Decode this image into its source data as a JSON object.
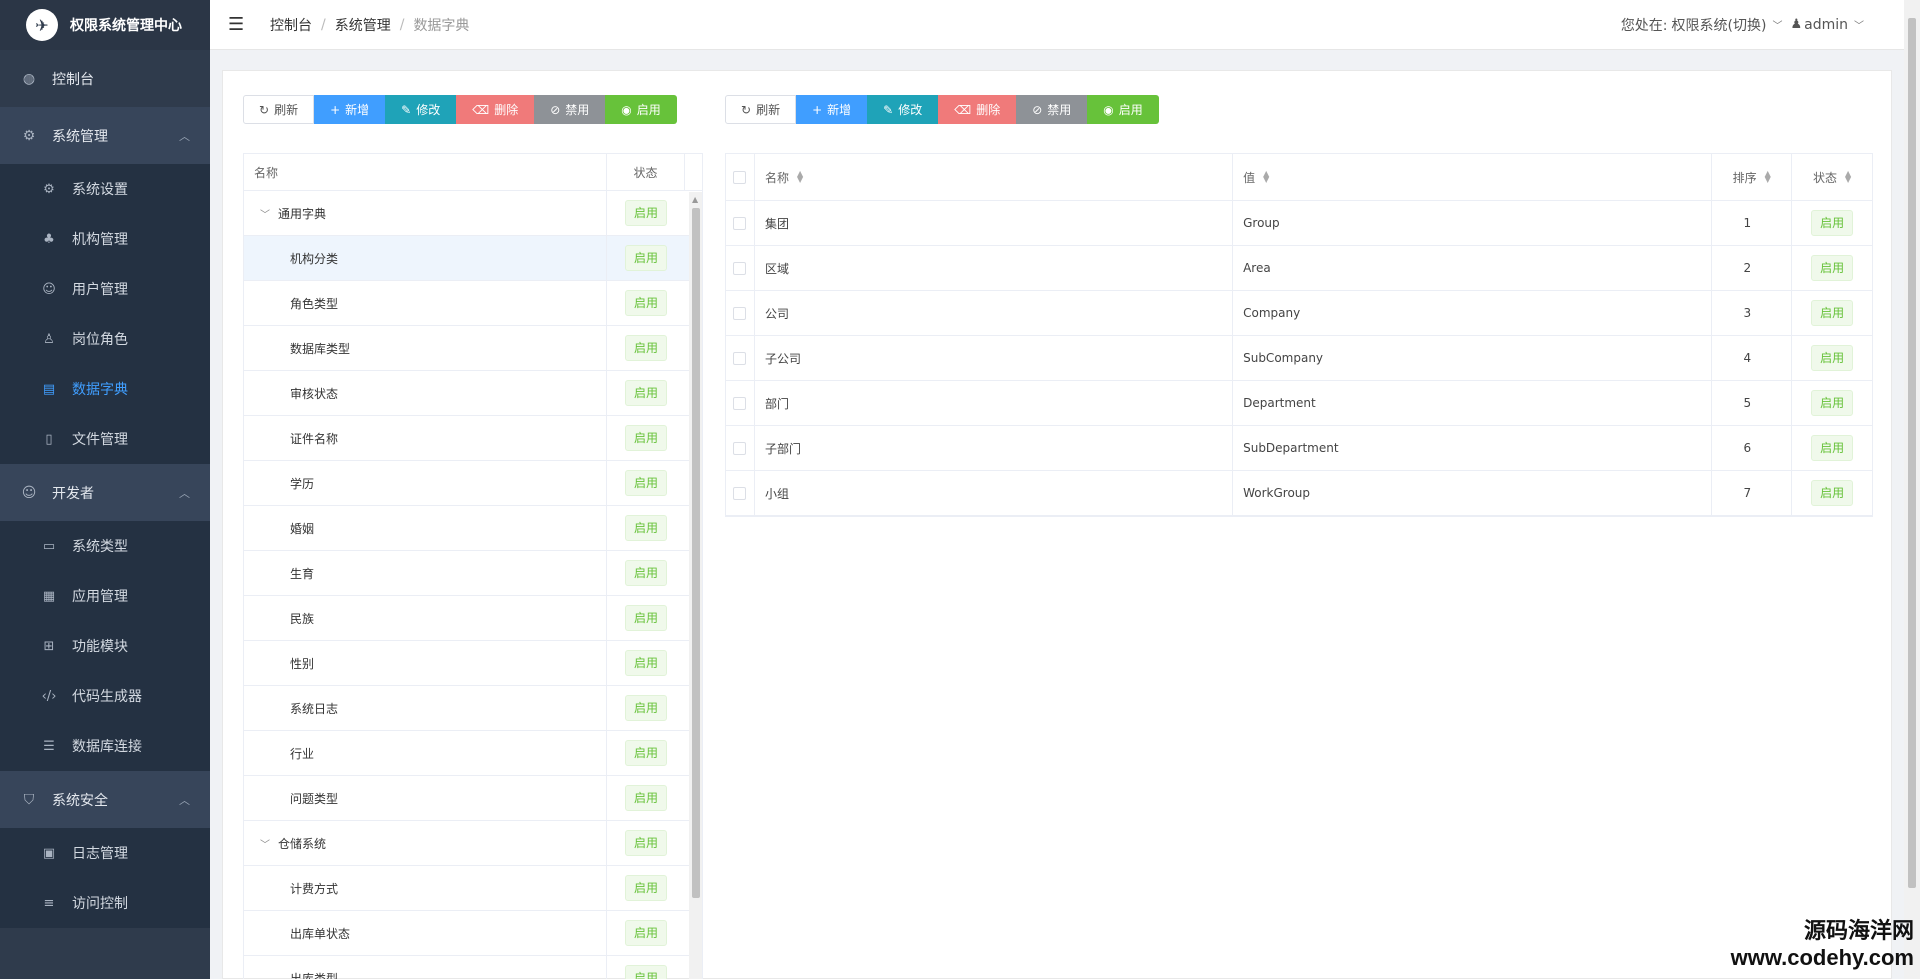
{
  "brand": {
    "title": "权限系统管理中心"
  },
  "sidebar": {
    "dashboard": "控制台",
    "groups": [
      {
        "title": "系统管理",
        "items": [
          "系统设置",
          "机构管理",
          "用户管理",
          "岗位角色",
          "数据字典",
          "文件管理"
        ]
      },
      {
        "title": "开发者",
        "items": [
          "系统类型",
          "应用管理",
          "功能模块",
          "代码生成器",
          "数据库连接"
        ]
      },
      {
        "title": "系统安全",
        "items": [
          "日志管理",
          "访问控制"
        ]
      }
    ],
    "active_item": "数据字典"
  },
  "header": {
    "breadcrumb": [
      "控制台",
      "系统管理",
      "数据字典"
    ],
    "location_prefix": "您处在:",
    "system_name": "权限系统(切换)",
    "user": "admin"
  },
  "toolbar": {
    "refresh": "刷新",
    "add": "新增",
    "edit": "修改",
    "delete": "删除",
    "disable": "禁用",
    "enable": "启用"
  },
  "tree": {
    "col_name": "名称",
    "col_status": "状态",
    "rows": [
      {
        "name": "通用字典",
        "level": 0,
        "status": "启用"
      },
      {
        "name": "机构分类",
        "level": 1,
        "status": "启用"
      },
      {
        "name": "角色类型",
        "level": 1,
        "status": "启用"
      },
      {
        "name": "数据库类型",
        "level": 1,
        "status": "启用"
      },
      {
        "name": "审核状态",
        "level": 1,
        "status": "启用"
      },
      {
        "name": "证件名称",
        "level": 1,
        "status": "启用"
      },
      {
        "name": "学历",
        "level": 1,
        "status": "启用"
      },
      {
        "name": "婚姻",
        "level": 1,
        "status": "启用"
      },
      {
        "name": "生育",
        "level": 1,
        "status": "启用"
      },
      {
        "name": "民族",
        "level": 1,
        "status": "启用"
      },
      {
        "name": "性别",
        "level": 1,
        "status": "启用"
      },
      {
        "name": "系统日志",
        "level": 1,
        "status": "启用"
      },
      {
        "name": "行业",
        "level": 1,
        "status": "启用"
      },
      {
        "name": "问题类型",
        "level": 1,
        "status": "启用"
      },
      {
        "name": "仓储系统",
        "level": 0,
        "status": "启用"
      },
      {
        "name": "计费方式",
        "level": 1,
        "status": "启用"
      },
      {
        "name": "出库单状态",
        "level": 1,
        "status": "启用"
      },
      {
        "name": "出库类型",
        "level": 1,
        "status": "启用"
      }
    ],
    "selected": "机构分类"
  },
  "table": {
    "columns": {
      "name": "名称",
      "value": "值",
      "sort": "排序",
      "status": "状态"
    },
    "rows": [
      {
        "name": "集团",
        "value": "Group",
        "sort": "1",
        "status": "启用"
      },
      {
        "name": "区域",
        "value": "Area",
        "sort": "2",
        "status": "启用"
      },
      {
        "name": "公司",
        "value": "Company",
        "sort": "3",
        "status": "启用"
      },
      {
        "name": "子公司",
        "value": "SubCompany",
        "sort": "4",
        "status": "启用"
      },
      {
        "name": "部门",
        "value": "Department",
        "sort": "5",
        "status": "启用"
      },
      {
        "name": "子部门",
        "value": "SubDepartment",
        "sort": "6",
        "status": "启用"
      },
      {
        "name": "小组",
        "value": "WorkGroup",
        "sort": "7",
        "status": "启用"
      }
    ]
  },
  "watermark": {
    "line1": "源码海洋网",
    "line2": "www.codehy.com"
  }
}
